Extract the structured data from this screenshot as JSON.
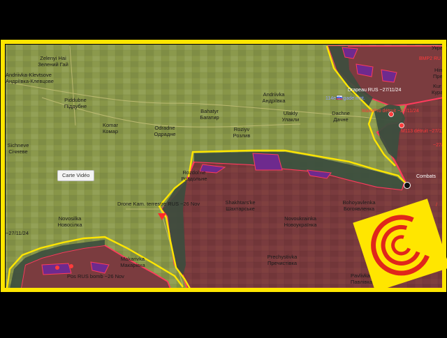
{
  "colors": {
    "frame": "#ffe600",
    "frontline": "#ffe600",
    "russian_zone": "#7b3c3f",
    "russian_border": "#ff3b5c",
    "contested": "#3c4e3e",
    "advance": "#6e2a8e",
    "terrain": "#8e9a4e",
    "logo_bg": "#ffe600",
    "logo_ring": "#e0261b"
  },
  "map": {
    "places": [
      {
        "id": "zelenyi-hai",
        "latin": "Zelenyi Hai",
        "cyr": "Зелений Гай"
      },
      {
        "id": "andriivka-klevtsove",
        "latin": "Andriivka-Klevtsove",
        "cyr": "Андріївка-Клевцове"
      },
      {
        "id": "piddubne",
        "latin": "Piddubne",
        "cyr": "Піддубне"
      },
      {
        "id": "komar",
        "latin": "Komar",
        "cyr": "Комар"
      },
      {
        "id": "odradne",
        "latin": "Odradne",
        "cyr": "Одрадне"
      },
      {
        "id": "bahatyr",
        "latin": "Bahatyr",
        "cyr": "Багатир"
      },
      {
        "id": "andriivka",
        "latin": "Andriivka",
        "cyr": "Андріївка"
      },
      {
        "id": "ulakly",
        "latin": "Ulakly",
        "cyr": "Улакли"
      },
      {
        "id": "dachne",
        "latin": "Dachne",
        "cyr": "Дачне"
      },
      {
        "id": "roziyv",
        "latin": "Roziyv",
        "cyr": "Розлив"
      },
      {
        "id": "sichneve",
        "latin": "Sichneve",
        "cyr": "Січневе"
      },
      {
        "id": "rozdolne",
        "latin": "Rozdol'ne",
        "cyr": "Роздольне"
      },
      {
        "id": "shakhtarske",
        "latin": "Shakhtars'ke",
        "cyr": "Шахтарське"
      },
      {
        "id": "bohoyavlenka",
        "latin": "Bohoyavlenka",
        "cyr": "Богоявленка"
      },
      {
        "id": "novoukrainka",
        "latin": "Novoukrainka",
        "cyr": "Новоукраїнка"
      },
      {
        "id": "novosilka",
        "latin": "Novosilka",
        "cyr": "Новосілка"
      },
      {
        "id": "makarivka",
        "latin": "Makarivka",
        "cyr": "Макарівка"
      },
      {
        "id": "prechystivka",
        "latin": "Prechystivka",
        "cyr": "Пречистівка"
      },
      {
        "id": "pavlivka",
        "latin": "Pavlivka",
        "cyr": "Павлівка"
      }
    ],
    "events": [
      {
        "id": "drapeau",
        "text": "Drapeau RUS ~27/11/24",
        "color": "#ffffff"
      },
      {
        "id": "brigade",
        "text": "114e Brigade mot.",
        "color": "#8fa0ff"
      },
      {
        "id": "maxxpro",
        "text": "MaxxPro détruit ~27/11/24",
        "color": "#ff3b3b"
      },
      {
        "id": "m113",
        "text": "M113 détruit ~27/11",
        "color": "#ff3b3b"
      },
      {
        "id": "combats",
        "text": "Combats",
        "color": "#ffffff"
      },
      {
        "id": "drone",
        "text": "Drone Kam. terrestre RUS ~26 Nov",
        "color": "#1a1a1a"
      },
      {
        "id": "bomb",
        "text": "Pos RUS bomb ~26 Nov",
        "color": "#1a1a1a"
      },
      {
        "id": "date-left",
        "text": "~27/11/24",
        "color": "#1a1a1a"
      }
    ],
    "edge_labels": {
      "top_right_1": "Україна",
      "top_right_2": "BMP2 RU",
      "right_1": "Him",
      "right_2": "Пре",
      "right_3": "Kur",
      "right_4": "Кура",
      "right_5": "~27/",
      "right_6": "/"
    }
  },
  "video_button": {
    "label": "Carte Vidéo"
  }
}
